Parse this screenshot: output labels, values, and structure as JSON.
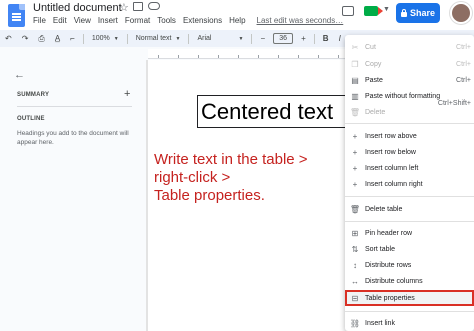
{
  "header": {
    "doc_title": "Untitled document",
    "menus": [
      "File",
      "Edit",
      "View",
      "Insert",
      "Format",
      "Tools",
      "Extensions",
      "Help"
    ],
    "last_edit": "Last edit was seconds…",
    "share_label": "Share"
  },
  "toolbar": {
    "zoom": "100%",
    "style": "Normal text",
    "font": "Arial",
    "font_size": "36",
    "decrease": "−",
    "increase": "+"
  },
  "outline": {
    "summary_label": "SUMMARY",
    "outline_label": "OUTLINE",
    "help_text": "Headings you add to the document will appear here."
  },
  "document": {
    "table_text": "Centered text",
    "instruction_lines": [
      "Write text in the table >",
      "right-click >",
      "Table properties."
    ]
  },
  "context_menu": {
    "items": [
      {
        "label": "Cut",
        "shortcut": "Ctrl+",
        "icon": "scissors-icon",
        "disabled": true
      },
      {
        "label": "Copy",
        "shortcut": "Ctrl+",
        "icon": "copy-icon",
        "disabled": true
      },
      {
        "label": "Paste",
        "shortcut": "Ctrl+",
        "icon": "paste-icon",
        "disabled": false
      },
      {
        "label": "Paste without formatting",
        "shortcut": "Ctrl+Shift+",
        "icon": "paste-plain-icon",
        "disabled": false
      },
      {
        "label": "Delete",
        "shortcut": "",
        "icon": "trash-icon",
        "disabled": true
      },
      {
        "label": "Insert row above",
        "shortcut": "",
        "icon": "plus-icon",
        "disabled": false
      },
      {
        "label": "Insert row below",
        "shortcut": "",
        "icon": "plus-icon",
        "disabled": false
      },
      {
        "label": "Insert column left",
        "shortcut": "",
        "icon": "plus-icon",
        "disabled": false
      },
      {
        "label": "Insert column right",
        "shortcut": "",
        "icon": "plus-icon",
        "disabled": false
      },
      {
        "label": "Delete table",
        "shortcut": "",
        "icon": "trash-icon",
        "disabled": false
      },
      {
        "label": "Pin header row",
        "shortcut": "",
        "icon": "pin-icon",
        "disabled": false
      },
      {
        "label": "Sort table",
        "shortcut": "",
        "icon": "sort-icon",
        "disabled": false
      },
      {
        "label": "Distribute rows",
        "shortcut": "",
        "icon": "distribute-rows-icon",
        "disabled": false
      },
      {
        "label": "Distribute columns",
        "shortcut": "",
        "icon": "distribute-columns-icon",
        "disabled": false
      },
      {
        "label": "Table properties",
        "shortcut": "",
        "icon": "table-icon",
        "disabled": false
      },
      {
        "label": "Insert link",
        "shortcut": "",
        "icon": "link-icon",
        "disabled": false
      }
    ]
  }
}
